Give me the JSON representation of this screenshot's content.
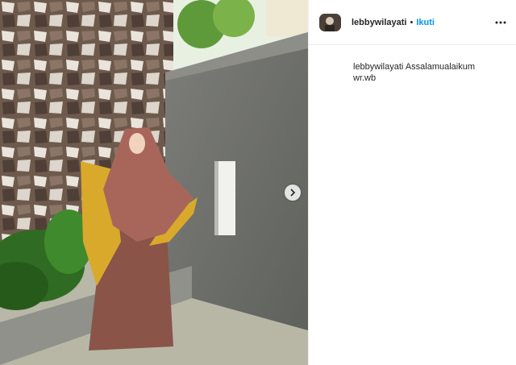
{
  "post": {
    "photo": {
      "alt_icon": "photo",
      "next_icon": "chevron-right-icon"
    },
    "header": {
      "username": "lebbywilayati",
      "separator": "•",
      "follow_label": "Ikuti",
      "more_icon": "more-horizontal-icon"
    },
    "caption": {
      "username": "lebbywilayati",
      "text": "Assalamualaikum wr.wb"
    },
    "colors": {
      "follow_blue": "#0095f6",
      "text": "#262626",
      "divider": "#efefef"
    }
  }
}
